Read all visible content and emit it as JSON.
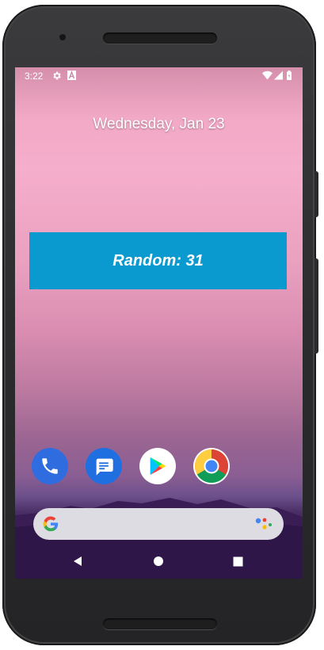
{
  "status_bar": {
    "time": "3:22",
    "left_icons": [
      "gear-icon",
      "a-notification-icon"
    ],
    "right_icons": [
      "wifi-icon",
      "cell-signal-icon",
      "battery-icon"
    ]
  },
  "home": {
    "date": "Wednesday, Jan 23"
  },
  "widget": {
    "text": "Random: 31",
    "background_color": "#0a9ad0"
  },
  "dock": {
    "apps": [
      {
        "name": "Phone",
        "icon": "phone-icon",
        "color": "#2f6ce0"
      },
      {
        "name": "Messages",
        "icon": "messages-icon",
        "color": "#1f6fe0"
      },
      {
        "name": "Play Store",
        "icon": "play-store-icon",
        "color": "#ffffff"
      },
      {
        "name": "Chrome",
        "icon": "chrome-icon",
        "color": "#ffffff"
      }
    ]
  },
  "search_bar": {
    "left_icon": "google-g-icon",
    "right_icon": "assistant-icon"
  },
  "nav_bar": {
    "buttons": [
      "back-icon",
      "home-icon",
      "recents-icon"
    ]
  }
}
